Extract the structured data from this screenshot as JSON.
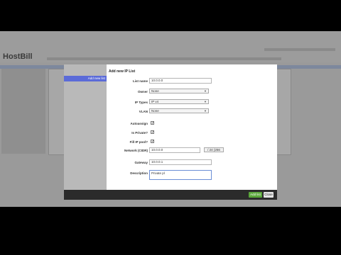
{
  "app": {
    "logo": "HostBill"
  },
  "modal": {
    "title": "Add new IP List",
    "sidebar_item": "Add new list",
    "fields": {
      "list_name": {
        "label": "List name",
        "value": "10.0.0.0"
      },
      "owner": {
        "label": "Owner",
        "value": "None"
      },
      "ip_types": {
        "label": "IP Types",
        "value": "IP v4"
      },
      "vlan": {
        "label": "VLAN",
        "value": "None"
      },
      "autoassign": {
        "label": "Autoassign",
        "checked": true
      },
      "is_private": {
        "label": "Is Private?",
        "checked": true
      },
      "fill_ip_pool": {
        "label": "Fill IP pool?",
        "checked": true
      },
      "network_cidr": {
        "label": "Network (CIDR)",
        "value": "10.0.0.0",
        "cidr": "/ 24 (256"
      },
      "gateway": {
        "label": "Gateway",
        "value": "10.0.0.1"
      },
      "description": {
        "label": "Description",
        "value": "Private pl"
      }
    },
    "buttons": {
      "add": "Add list",
      "close": "Close"
    }
  },
  "colors": {
    "accent": "#5b6bd8",
    "add_button": "#5aa63a",
    "footer": "#2b2b2b"
  }
}
